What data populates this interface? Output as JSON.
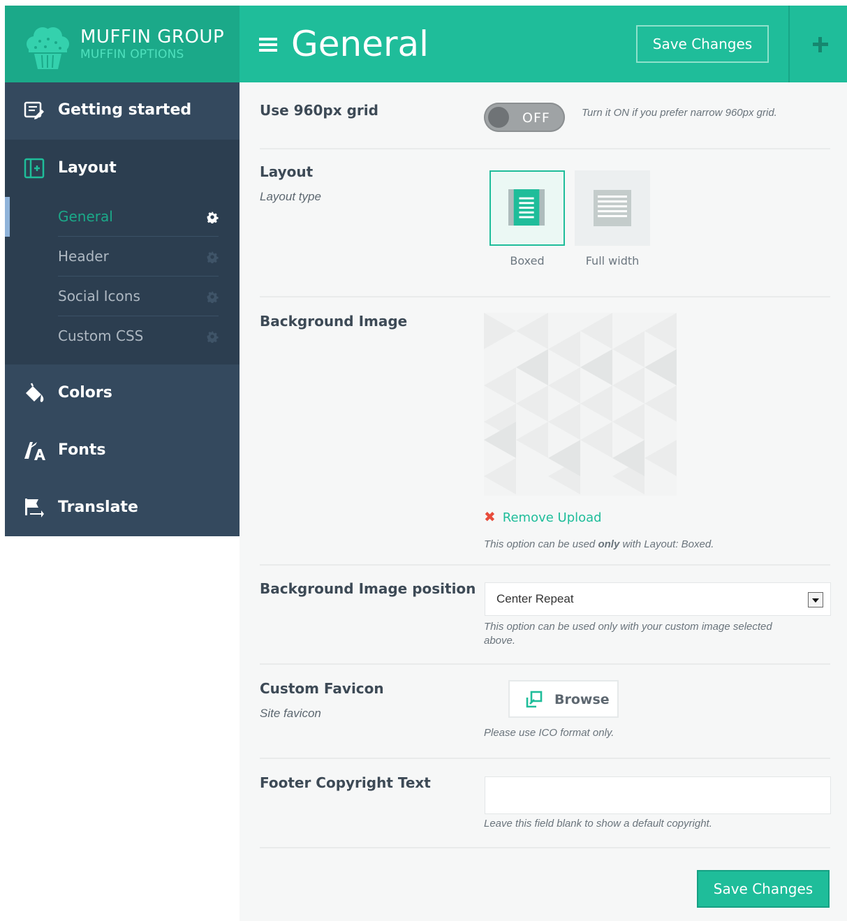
{
  "brand": {
    "name": "MUFFIN GROUP",
    "subtitle": "MUFFIN OPTIONS"
  },
  "sidebar": {
    "items": [
      {
        "label": "Getting started",
        "icon": "edit-note-icon"
      },
      {
        "label": "Layout",
        "icon": "layout-add-icon",
        "children": [
          {
            "label": "General",
            "active": true
          },
          {
            "label": "Header"
          },
          {
            "label": "Social Icons"
          },
          {
            "label": "Custom CSS"
          }
        ]
      },
      {
        "label": "Colors",
        "icon": "paint-bucket-icon"
      },
      {
        "label": "Fonts",
        "icon": "font-icon"
      },
      {
        "label": "Translate",
        "icon": "flag-icon"
      }
    ]
  },
  "header": {
    "title": "General",
    "save_label": "Save Changes"
  },
  "options": {
    "grid": {
      "name": "Use 960px grid",
      "state": "OFF",
      "hint": "Turn it ON if you prefer narrow 960px grid."
    },
    "layout": {
      "name": "Layout",
      "desc": "Layout type",
      "choices": [
        "Boxed",
        "Full width"
      ],
      "selected": "Boxed"
    },
    "bg_image": {
      "name": "Background Image",
      "remove_label": "Remove Upload",
      "hint_before": "This option can be used ",
      "hint_strong": "only",
      "hint_after": " with Layout: Boxed."
    },
    "bg_position": {
      "name": "Background Image position",
      "value": "Center Repeat",
      "hint_line1": "This option can be used only with your custom image selected",
      "hint_line2": "above."
    },
    "favicon": {
      "name": "Custom Favicon",
      "desc": "Site favicon",
      "button": "Browse",
      "hint": "Please use ICO format only."
    },
    "footer": {
      "name": "Footer Copyright Text",
      "value": "",
      "hint": "Leave this field blank to show a default copyright."
    }
  },
  "footer_save_label": "Save Changes",
  "colors": {
    "accent": "#1fbd9a",
    "accent_dark": "#1ba989",
    "sidebar": "#2c3e50",
    "sidebar_item": "#34495e",
    "danger": "#e74c3c"
  }
}
